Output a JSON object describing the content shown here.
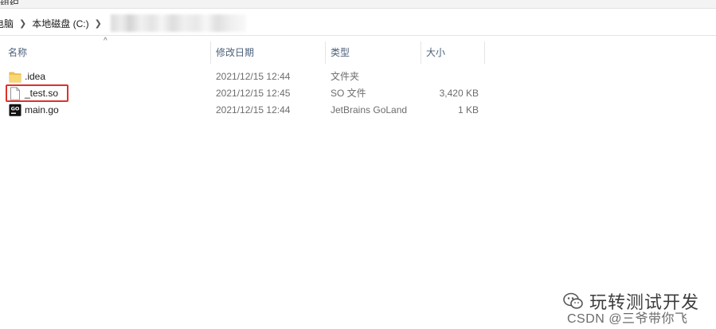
{
  "window": {
    "top_fragment": "组织"
  },
  "address": {
    "crumbs": [
      "电脑",
      "本地磁盘 (C:)"
    ]
  },
  "columns": {
    "name": "名称",
    "date": "修改日期",
    "type": "类型",
    "size": "大小",
    "sort_indicator": "^"
  },
  "files": [
    {
      "name": ".idea",
      "date": "2021/12/15 12:44",
      "type": "文件夹",
      "size": "",
      "icon": "folder-icon"
    },
    {
      "name": "_test.so",
      "date": "2021/12/15 12:45",
      "type": "SO 文件",
      "size": "3,420 KB",
      "icon": "blank-file-icon"
    },
    {
      "name": "main.go",
      "date": "2021/12/15 12:44",
      "type": "JetBrains GoLand",
      "size": "1 KB",
      "icon": "goland-file-icon"
    }
  ],
  "watermark": {
    "title": "玩转测试开发",
    "credit": "CSDN @三爷带你飞"
  },
  "colors": {
    "highlight": "#e0302b",
    "header_text": "#4c607a",
    "folder": "#f3c44d"
  }
}
